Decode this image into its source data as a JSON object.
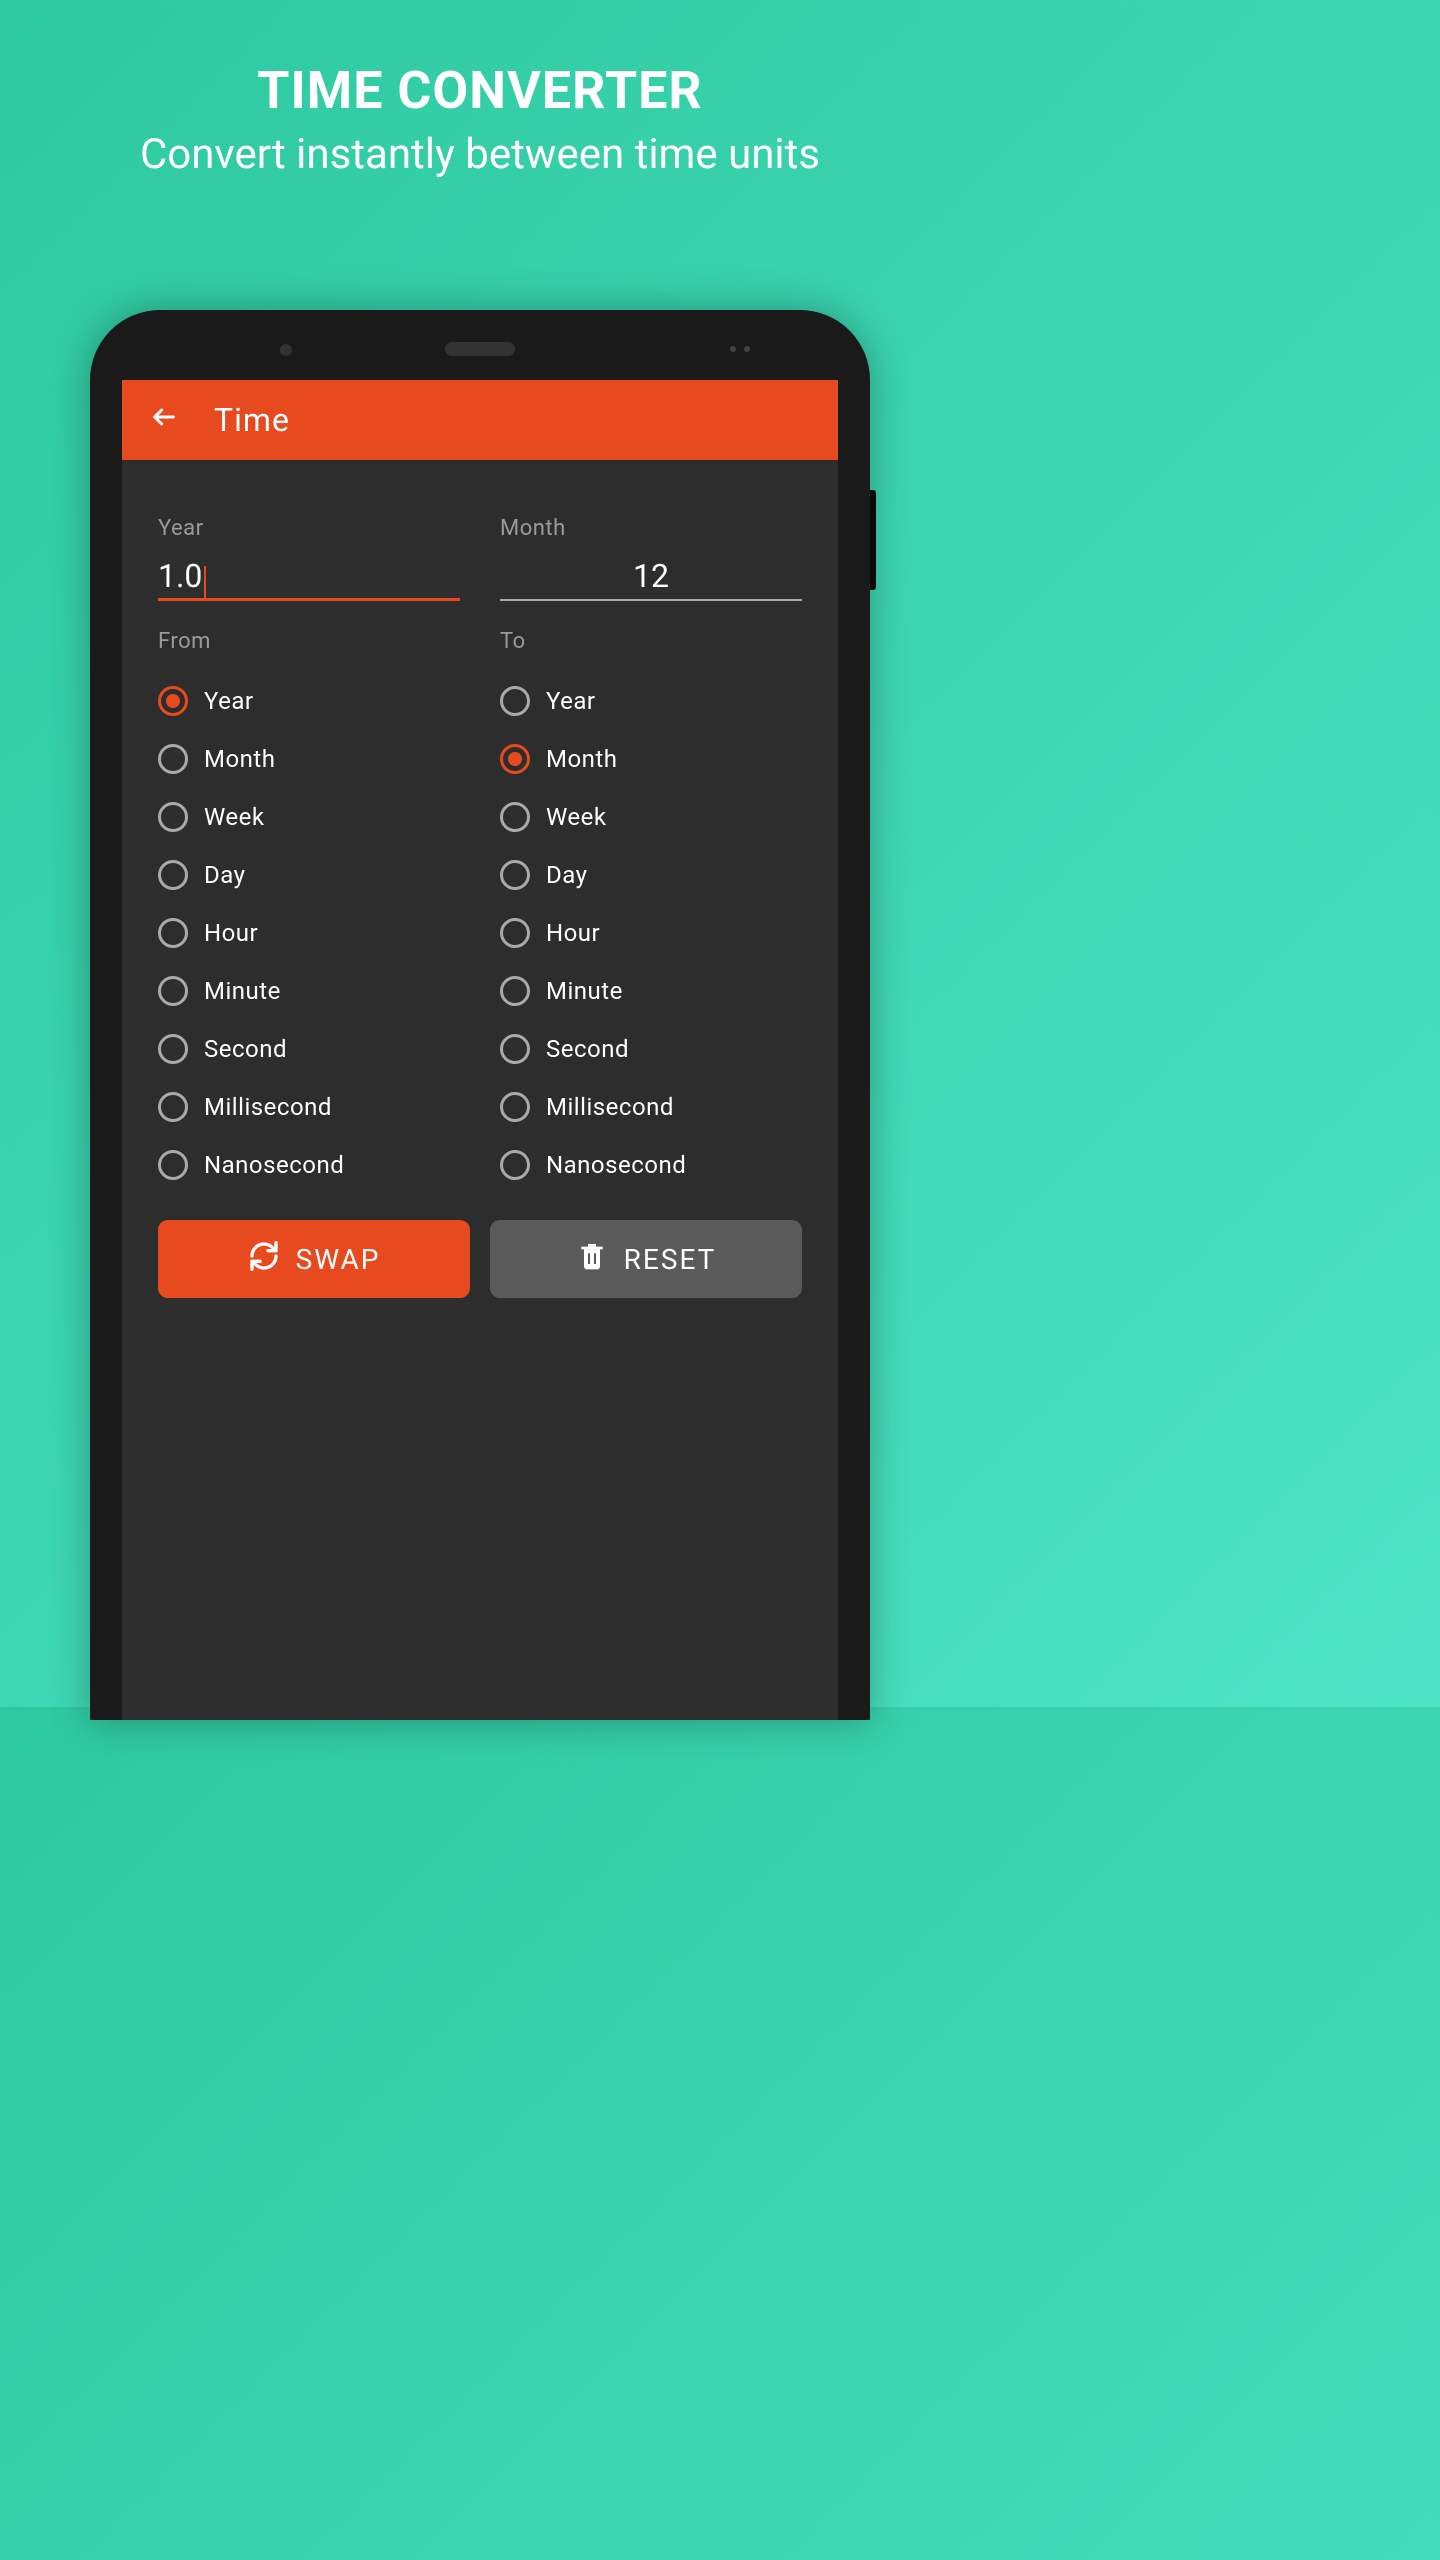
{
  "promo": {
    "title": "TIME CONVERTER",
    "subtitle": "Convert instantly between time units"
  },
  "appbar": {
    "title": "Time"
  },
  "inputs": {
    "from_label": "Year",
    "from_value": "1.0",
    "to_label": "Month",
    "to_value": "12"
  },
  "sections": {
    "from_label": "From",
    "to_label": "To"
  },
  "units": [
    "Year",
    "Month",
    "Week",
    "Day",
    "Hour",
    "Minute",
    "Second",
    "Millisecond",
    "Nanosecond"
  ],
  "selected": {
    "from_index": 0,
    "to_index": 1
  },
  "buttons": {
    "swap": "SWAP",
    "reset": "RESET"
  },
  "colors": {
    "accent": "#e84a1f",
    "bg_dark": "#2d2d2d",
    "gradient_start": "#2ec9a0"
  }
}
